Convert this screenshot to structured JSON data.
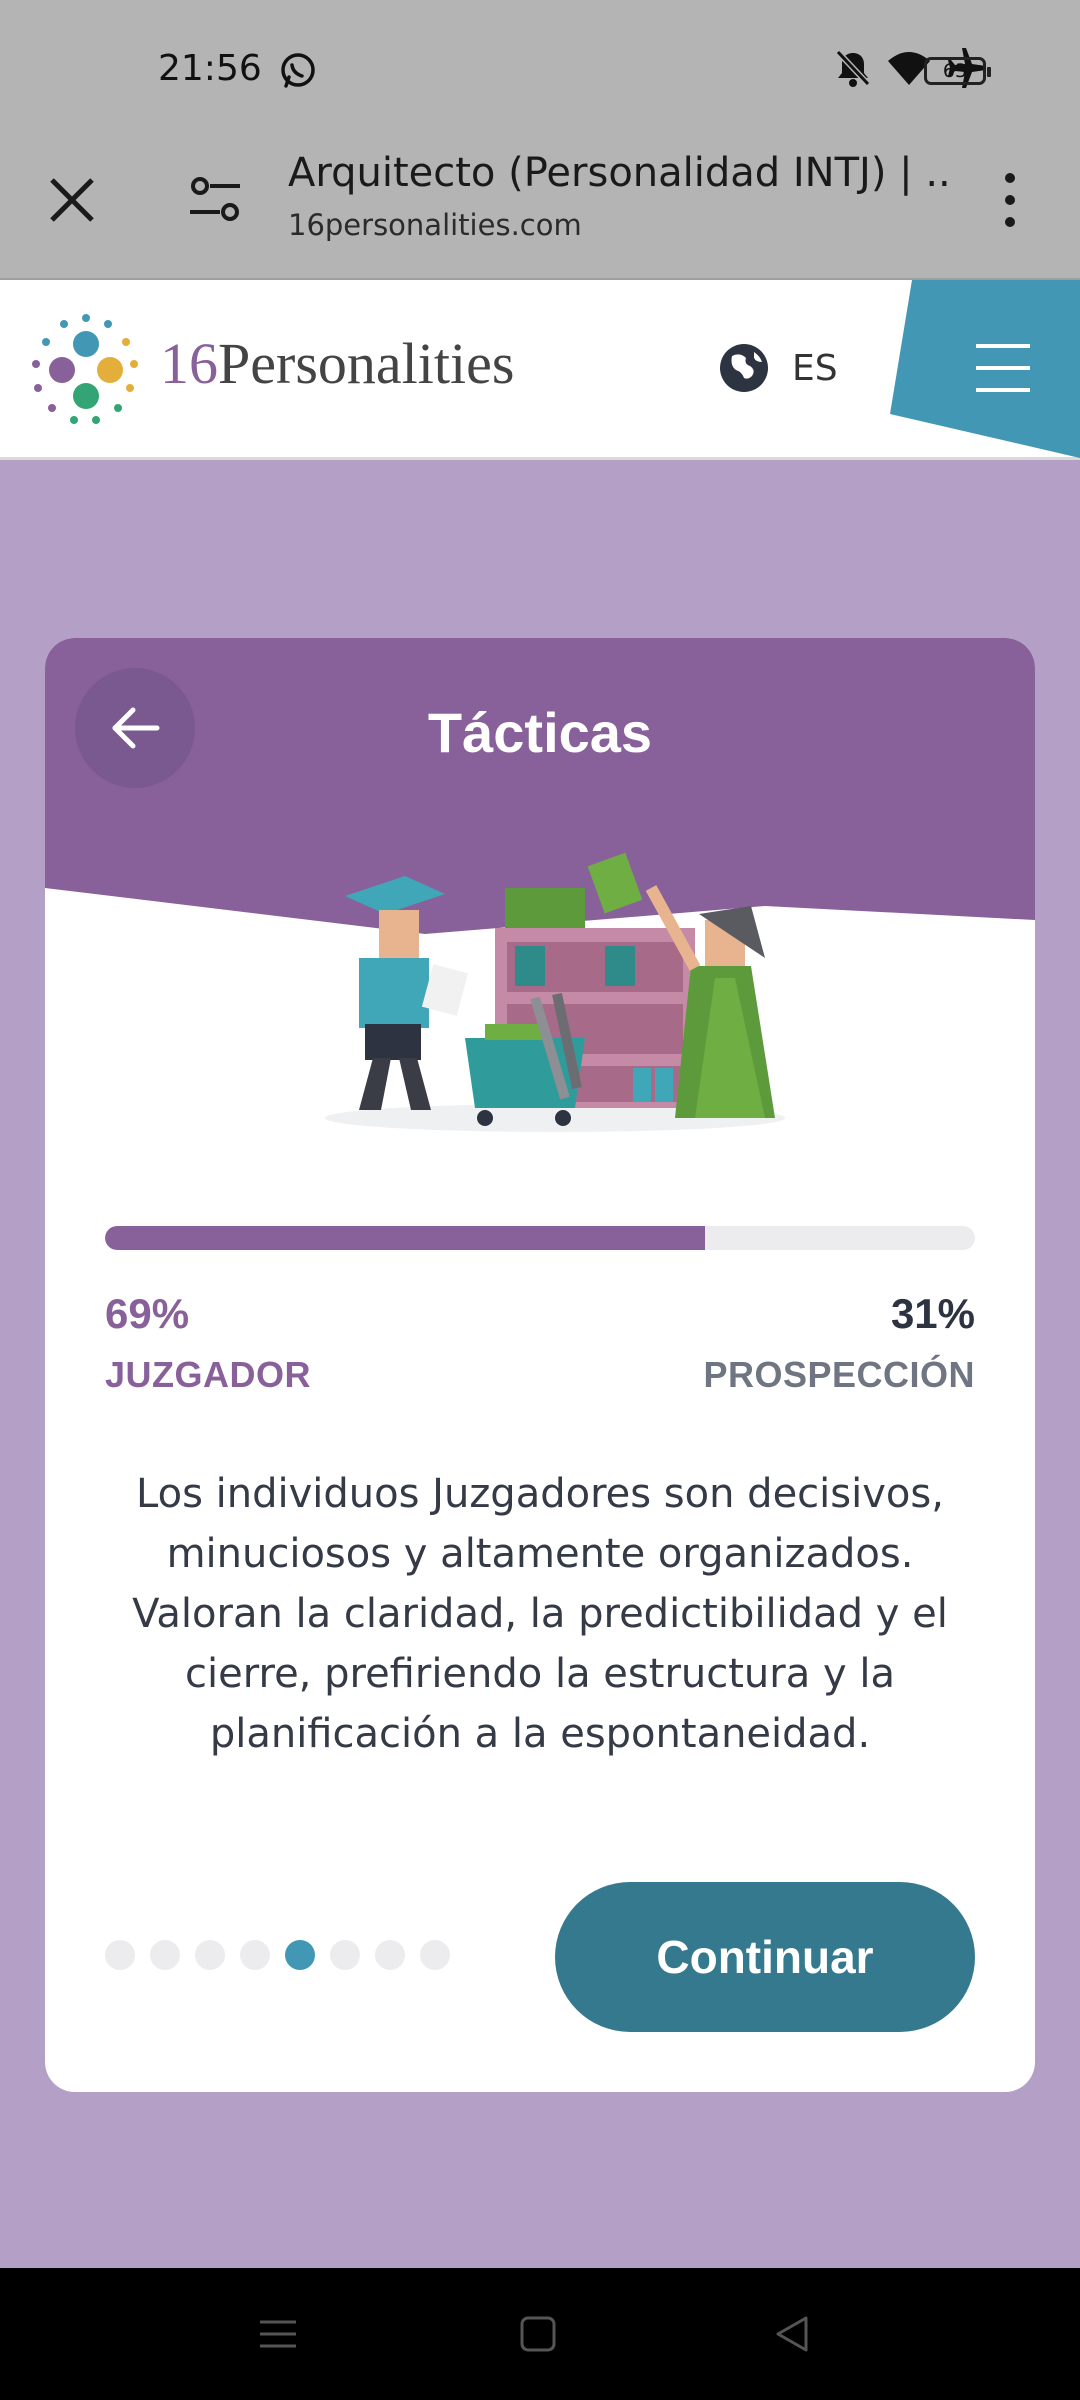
{
  "status_bar": {
    "time": "21:56",
    "battery": "63",
    "icons": [
      "whatsapp-icon",
      "bell-off-icon",
      "wifi-icon",
      "airplane-icon",
      "battery-icon"
    ]
  },
  "browser": {
    "tab_title": "Arquitecto (Personalidad INTJ) | ...",
    "url": "16personalities.com",
    "icons": [
      "close-icon",
      "tune-icon",
      "more-vert-icon"
    ]
  },
  "site_header": {
    "logo_number": "16",
    "logo_word": "Personalities",
    "language": "ES",
    "icons": [
      "globe-icon",
      "menu-icon"
    ]
  },
  "card": {
    "title": "Tácticas",
    "header_color": "#88619a",
    "progress_fraction": 0.69,
    "left_percent": "69%",
    "left_trait": "JUZGADOR",
    "right_percent": "31%",
    "right_trait": "PROSPECCIÓN",
    "description": "Los individuos Juzgadores son decisivos, minuciosos y altamente organizados. Valoran la claridad, la predictibilidad y el cierre, prefiriendo la estructura y la planificación a la espontaneidad.",
    "pagination": {
      "total": 8,
      "active_index": 4,
      "active_color": "#4298b4"
    },
    "continue_label": "Continuar",
    "button_color": "#35798f"
  },
  "nav_bar": {
    "icons": [
      "recents-icon",
      "home-icon",
      "back-icon"
    ]
  }
}
